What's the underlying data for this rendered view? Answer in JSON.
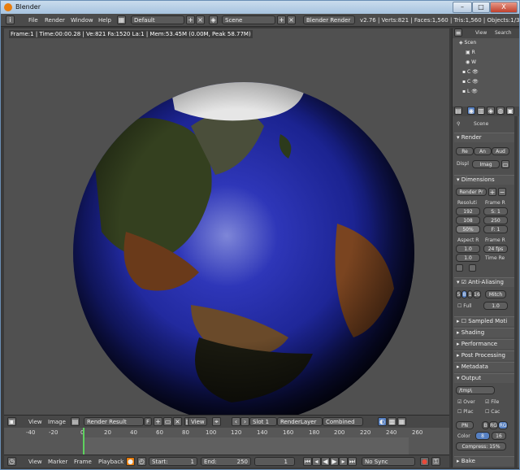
{
  "titlebar": {
    "title": "Blender",
    "min": "–",
    "max": "□",
    "close": "X"
  },
  "info": {
    "menus": [
      "File",
      "Render",
      "Window",
      "Help"
    ],
    "layout": "Default",
    "scene": "Scene",
    "engine": "Blender Render",
    "stats": "v2.76 | Verts:821 | Faces:1,560 | Tris:1,560 | Objects:1/3 | L"
  },
  "viewport": {
    "header_text": "Frame:1 | Time:00:00.28 | Ve:821 Fa:1520 La:1 | Mem:53.45M (0.00M, Peak 58.77M)"
  },
  "image_editor": {
    "view": "View",
    "image": "Image",
    "image_name": "Render Result",
    "f": "F",
    "view2": "View",
    "slot": "Slot 1",
    "layer": "RenderLayer",
    "pass": "Combined"
  },
  "timeline": {
    "ticks": [
      "-40",
      "-20",
      "0",
      "20",
      "40",
      "60",
      "80",
      "100",
      "120",
      "140",
      "160",
      "180",
      "200",
      "220",
      "240",
      "260"
    ],
    "view": "View",
    "marker": "Marker",
    "frame": "Frame",
    "playback": "Playback",
    "start": "Start:",
    "start_val": "1",
    "end": "End:",
    "end_val": "250",
    "current": "1",
    "sync": "No Sync"
  },
  "outliner": {
    "view": "View",
    "search": "Search",
    "rows": [
      "Scen",
      "R",
      "W",
      "C",
      "C",
      "L"
    ]
  },
  "properties": {
    "scene_label": "Scene",
    "render": "Render",
    "render_buttons": [
      "Re",
      "An",
      "Aud"
    ],
    "display_label": "Displ",
    "display_val": "Imag",
    "dimensions": "Dimensions",
    "preset": "Render Pr",
    "resolution": "Resoluti",
    "frame_range": "Frame R",
    "res_x": "192",
    "res_y": "108",
    "res_pct": "50%",
    "start": "S: 1",
    "end": "250",
    "step": "F: 1",
    "aspect": "Aspect R",
    "frame_rate": "Frame R",
    "aspect_x": "1.0",
    "aspect_y": "1.0",
    "fps": "24 fps",
    "time_remap": "Time Re",
    "anti_aliasing": "Anti-Aliasing",
    "aa_samples": [
      "5",
      "8",
      "1",
      "16"
    ],
    "filter": "Mitch",
    "full": "Full",
    "filter_size": "1.0",
    "sampled_motion": "Sampled Moti",
    "shading": "Shading",
    "performance": "Performance",
    "post_processing": "Post Processing",
    "metadata": "Metadata",
    "output": "Output",
    "output_path": "/tmp\\",
    "overwrite": "Over",
    "file_ext": "File",
    "placeholders": "Plac",
    "cache": "Cac",
    "format": "PN",
    "bw": "B",
    "rgb": "RG",
    "rgba": "RG",
    "color": "Color",
    "depth8": "8",
    "depth16": "16",
    "compress": "Compress: 15%",
    "bake": "Bake"
  },
  "colors": {
    "accent": "#e87d0d",
    "frame_marker": "#5ed15e",
    "selected": "#5680c2"
  }
}
